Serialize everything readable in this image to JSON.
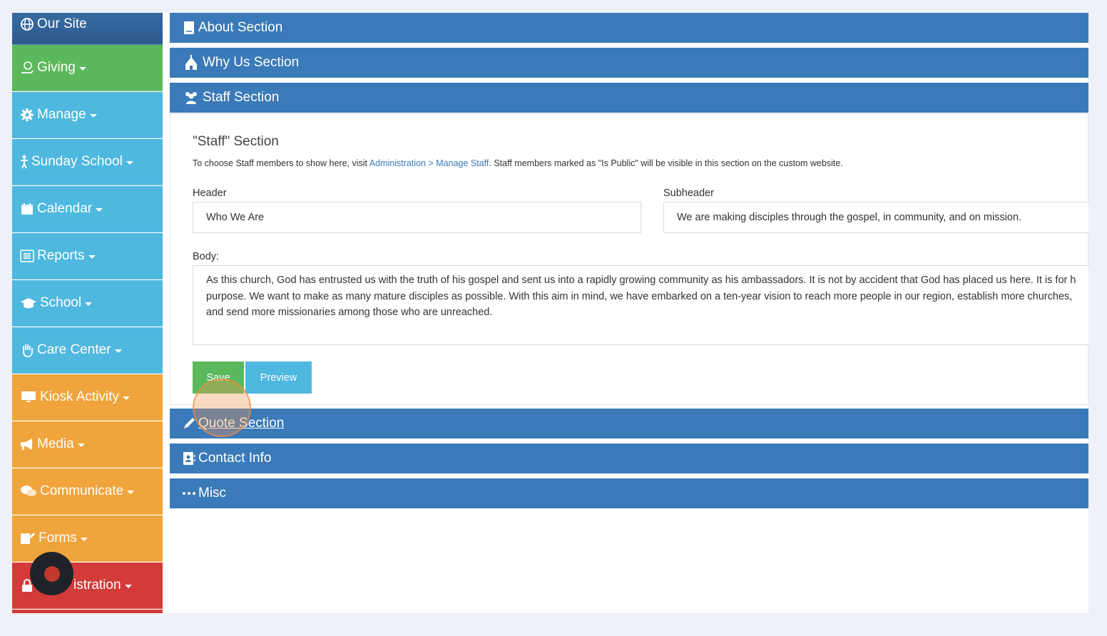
{
  "sidebar": {
    "items": [
      {
        "label": "Our Site",
        "icon": "globe-icon",
        "color": "#2c5a8e"
      },
      {
        "label": "Giving",
        "icon": "money-hand-icon",
        "color": "#5cb85c"
      },
      {
        "label": "Manage",
        "icon": "gear-icon",
        "color": "#4eb8df"
      },
      {
        "label": "Sunday School",
        "icon": "child-icon",
        "color": "#4eb8df"
      },
      {
        "label": "Calendar",
        "icon": "calendar-icon",
        "color": "#4eb8df"
      },
      {
        "label": "Reports",
        "icon": "list-icon",
        "color": "#4eb8df"
      },
      {
        "label": "School",
        "icon": "graduation-cap-icon",
        "color": "#4eb8df"
      },
      {
        "label": "Care Center",
        "icon": "hand-icon",
        "color": "#4eb8df"
      },
      {
        "label": "Kiosk Activity",
        "icon": "monitor-icon",
        "color": "#f0a43c"
      },
      {
        "label": "Media",
        "icon": "megaphone-icon",
        "color": "#f0a43c"
      },
      {
        "label": "Communicate",
        "icon": "chat-icon",
        "color": "#f0a43c"
      },
      {
        "label": "Forms",
        "icon": "edit-form-icon",
        "color": "#f0a43c"
      },
      {
        "label": "istration",
        "icon": "lock-icon",
        "color": "#d33a3a"
      }
    ]
  },
  "sections": {
    "about": "About Section",
    "why_us": "Why Us Section",
    "staff": "Staff Section",
    "quote": "Quote Section",
    "contact": "Contact Info",
    "misc": "Misc"
  },
  "staff_panel": {
    "title": "\"Staff\" Section",
    "info_prefix": "To choose Staff members to show here, visit ",
    "info_link": "Administration > Manage Staff",
    "info_suffix": ". Staff members marked as \"Is Public\" will be visible in this section on the custom website.",
    "header_label": "Header",
    "header_value": "Who We Are",
    "subheader_label": "Subheader",
    "subheader_value": "We are making disciples through the gospel, in community, and on mission.",
    "body_label": "Body:",
    "body_value": "As this church, God has entrusted us with the truth of his gospel and sent us into a rapidly growing community as his ambassadors. It is not by accident that God has placed us here. It is for h purpose. We want to make as many mature disciples as possible. With this aim in mind, we have embarked on a ten-year vision to reach more people in our region, establish more churches, and send more missionaries among those who are unreached.",
    "save_label": "Save",
    "preview_label": "Preview"
  },
  "colors": {
    "section_header": "#3a7ab8",
    "save": "#5cb85c",
    "preview": "#4eb8df"
  }
}
